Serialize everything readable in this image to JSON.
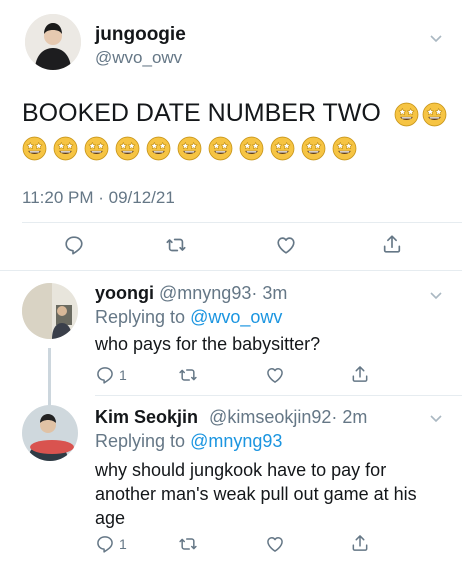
{
  "main_tweet": {
    "display_name": "jungoogie",
    "handle": "@wvo_owv",
    "text": "BOOKED DATE NUMBER TWO",
    "timestamp": "11:20 PM · 09/12/21"
  },
  "replies": [
    {
      "display_name": "yoongi",
      "handle": "@mnyng93",
      "time": "· 3m",
      "replying_label": "Replying to",
      "replying_to": "@wvo_owv",
      "text": "who pays for the babysitter?",
      "reply_count": "1"
    },
    {
      "display_name": "Kim Seokjin",
      "handle": "@kimseokjin92",
      "time": "· 2m",
      "replying_label": "Replying to",
      "replying_to": "@mnyng93",
      "text": "why should jungkook have to pay for another man's weak pull out game at his age",
      "reply_count": "1"
    }
  ],
  "icons": [
    "reply-icon",
    "retweet-icon",
    "like-icon",
    "share-icon",
    "chevron-down-icon",
    "star-struck-emoji"
  ],
  "colors": {
    "link": "#1b95e0",
    "muted": "#657786",
    "thread_line": "#ccd6dd",
    "divider": "#e6ecf0"
  }
}
